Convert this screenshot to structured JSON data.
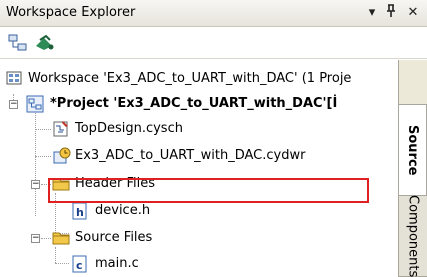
{
  "window": {
    "title": "Workspace Explorer",
    "pin_glyph": "▾ ᛰ",
    "close_glyph": "✕"
  },
  "toolbar": {
    "icons": [
      "tree-view-icon",
      "graph-icon"
    ]
  },
  "tree": {
    "workspace": "Workspace 'Ex3_ADC_to_UART_with_DAC' (1 Proje",
    "project": "*Project 'Ex3_ADC_to_UART_with_DAC'[İ",
    "items": [
      {
        "label": "TopDesign.cysch",
        "icon": "schematic-icon"
      },
      {
        "label": "Ex3_ADC_to_UART_with_DAC.cydwr",
        "icon": "design-wide-resources-icon"
      },
      {
        "label": "Header Files",
        "icon": "folder-icon"
      },
      {
        "label": "device.h",
        "icon": "header-file-icon"
      },
      {
        "label": "Source Files",
        "icon": "folder-icon"
      },
      {
        "label": "main.c",
        "icon": "c-file-icon"
      }
    ]
  },
  "tabs": [
    {
      "label": "Source",
      "active": true
    },
    {
      "label": "Components",
      "active": false
    }
  ],
  "colors": {
    "highlight_box": "#e02020",
    "folder": "#f2c84b",
    "tab_strip": "#ece9d8"
  }
}
